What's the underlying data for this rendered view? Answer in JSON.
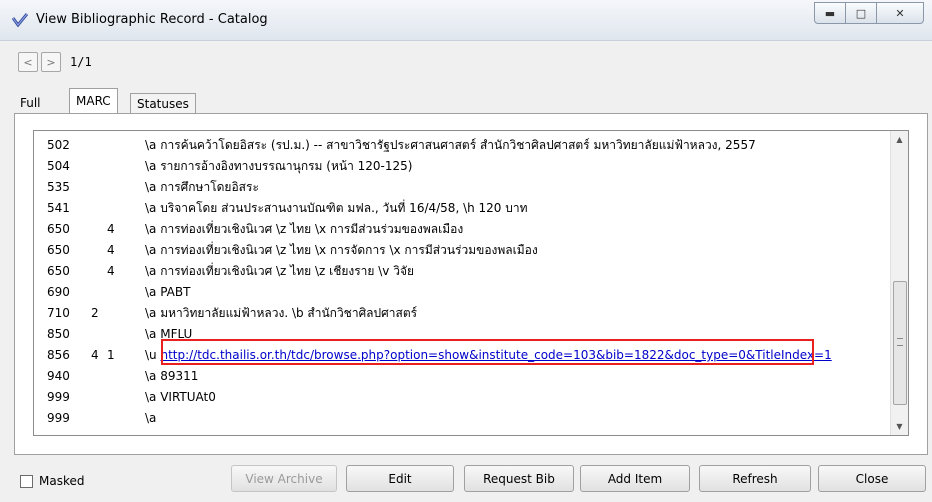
{
  "window": {
    "title": "View Bibliographic Record - Catalog"
  },
  "nav": {
    "prev": "<",
    "next": ">",
    "page_info": "1/1"
  },
  "tabs": [
    {
      "label": "Full"
    },
    {
      "label": "MARC"
    },
    {
      "label": "Statuses"
    }
  ],
  "records": [
    {
      "tag": "502",
      "ind1": "",
      "ind2": "",
      "value": "\\a การค้นคว้าโดยอิสระ (รป.ม.) -- สาขาวิชารัฐประศาสนศาสตร์ สำนักวิชาศิลปศาสตร์ มหาวิทยาลัยแม่ฟ้าหลวง, 2557"
    },
    {
      "tag": "504",
      "ind1": "",
      "ind2": "",
      "value": "\\a รายการอ้างอิงทางบรรณานุกรม (หน้า 120-125)"
    },
    {
      "tag": "535",
      "ind1": "",
      "ind2": "",
      "value": "\\a การศึกษาโดยอิสระ"
    },
    {
      "tag": "541",
      "ind1": "",
      "ind2": "",
      "value": "\\a บริจาคโดย ส่วนประสานงานบัณฑิต มฟล., วันที่ 16/4/58, \\h 120 บาท"
    },
    {
      "tag": "650",
      "ind1": "",
      "ind2": "4",
      "value": "\\a การท่องเที่ยวเชิงนิเวศ \\z ไทย \\x การมีส่วนร่วมของพลเมือง"
    },
    {
      "tag": "650",
      "ind1": "",
      "ind2": "4",
      "value": "\\a การท่องเที่ยวเชิงนิเวศ \\z ไทย \\x การจัดการ \\x การมีส่วนร่วมของพลเมือง"
    },
    {
      "tag": "650",
      "ind1": "",
      "ind2": "4",
      "value": "\\a การท่องเที่ยวเชิงนิเวศ \\z ไทย \\z เชียงราย \\v วิจัย"
    },
    {
      "tag": "690",
      "ind1": "",
      "ind2": "",
      "value": "\\a PABT"
    },
    {
      "tag": "710",
      "ind1": "2",
      "ind2": "",
      "value": "\\a มหาวิทยาลัยแม่ฟ้าหลวง. \\b สำนักวิชาศิลปศาสตร์"
    },
    {
      "tag": "850",
      "ind1": "",
      "ind2": "",
      "value": "\\a MFLU"
    },
    {
      "tag": "856",
      "ind1": "4",
      "ind2": "1",
      "value_prefix": "\\u ",
      "link": "http://tdc.thailis.or.th/tdc/browse.php?option=show&institute_code=103&bib=1822&doc_type=0&TitleIndex=1"
    },
    {
      "tag": "940",
      "ind1": "",
      "ind2": "",
      "value": "\\a 89311"
    },
    {
      "tag": "999",
      "ind1": "",
      "ind2": "",
      "value": "\\a VIRTUAt0"
    },
    {
      "tag": "999",
      "ind1": "",
      "ind2": "",
      "value": "\\a"
    }
  ],
  "footer": {
    "masked_label": "Masked",
    "buttons": [
      {
        "label": "View Archive",
        "enabled": false
      },
      {
        "label": "Edit",
        "enabled": true
      },
      {
        "label": "Request Bib",
        "enabled": true
      },
      {
        "label": "Add Item",
        "enabled": true
      },
      {
        "label": "Refresh",
        "enabled": true
      },
      {
        "label": "Close",
        "enabled": true
      }
    ]
  },
  "colors": {
    "link": "#0000cc",
    "highlight_border": "#e8201e"
  }
}
